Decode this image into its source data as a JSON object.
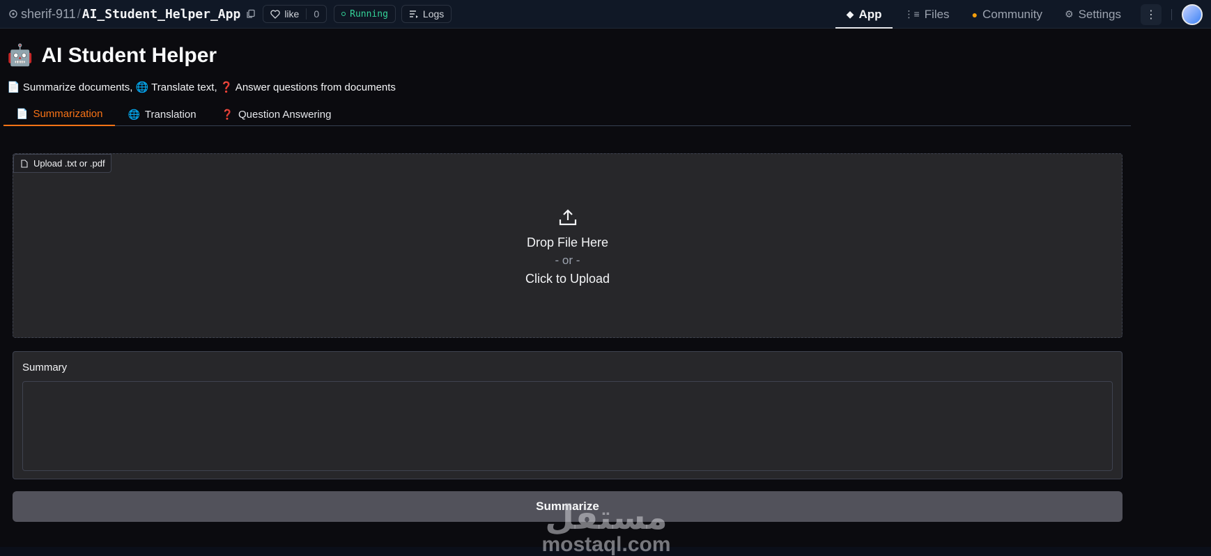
{
  "header": {
    "owner": "sherif-911",
    "separator": "/",
    "repo": "AI_Student_Helper_App",
    "like_label": "like",
    "like_count": "0",
    "status": "Running",
    "logs_label": "Logs",
    "nav": [
      {
        "label": "App",
        "icon": "cube-icon"
      },
      {
        "label": "Files",
        "icon": "files-icon"
      },
      {
        "label": "Community",
        "icon": "community-icon"
      },
      {
        "label": "Settings",
        "icon": "gear-icon"
      }
    ]
  },
  "app": {
    "title": "AI Student Helper",
    "subtitle": "📄 Summarize documents, 🌐 Translate text, ❓ Answer questions from documents",
    "tabs": [
      {
        "label": "Summarization",
        "icon": "📄"
      },
      {
        "label": "Translation",
        "icon": "🌐"
      },
      {
        "label": "Question Answering",
        "icon": "❓"
      }
    ],
    "upload_label": "Upload .txt or .pdf",
    "drop_text": "Drop File Here",
    "or_text": "- or -",
    "click_text": "Click to Upload",
    "summary_label": "Summary",
    "summary_value": "",
    "button_label": "Summarize"
  },
  "watermark": {
    "arabic": "مستقل",
    "latin": "mostaql.com"
  },
  "colors": {
    "accent": "#f97316",
    "running": "#34d399",
    "button": "#52525b"
  }
}
